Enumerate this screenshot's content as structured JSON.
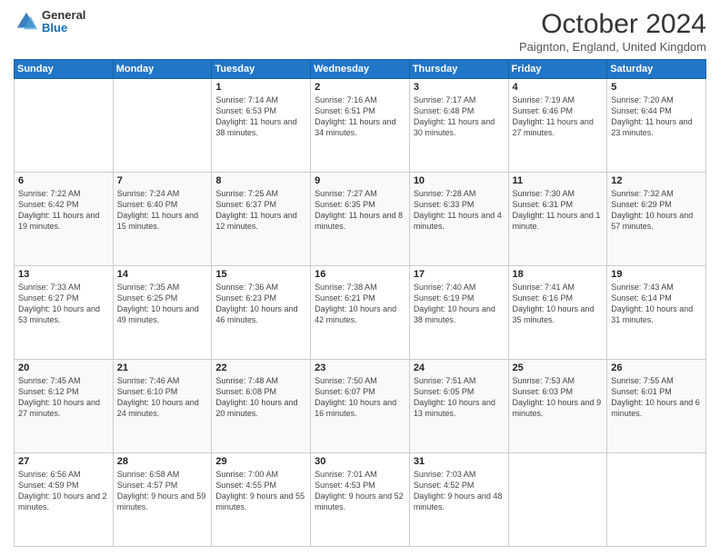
{
  "logo": {
    "general": "General",
    "blue": "Blue"
  },
  "header": {
    "title": "October 2024",
    "subtitle": "Paignton, England, United Kingdom"
  },
  "days_of_week": [
    "Sunday",
    "Monday",
    "Tuesday",
    "Wednesday",
    "Thursday",
    "Friday",
    "Saturday"
  ],
  "weeks": [
    [
      {
        "day": "",
        "info": ""
      },
      {
        "day": "",
        "info": ""
      },
      {
        "day": "1",
        "info": "Sunrise: 7:14 AM\nSunset: 6:53 PM\nDaylight: 11 hours and 38 minutes."
      },
      {
        "day": "2",
        "info": "Sunrise: 7:16 AM\nSunset: 6:51 PM\nDaylight: 11 hours and 34 minutes."
      },
      {
        "day": "3",
        "info": "Sunrise: 7:17 AM\nSunset: 6:48 PM\nDaylight: 11 hours and 30 minutes."
      },
      {
        "day": "4",
        "info": "Sunrise: 7:19 AM\nSunset: 6:46 PM\nDaylight: 11 hours and 27 minutes."
      },
      {
        "day": "5",
        "info": "Sunrise: 7:20 AM\nSunset: 6:44 PM\nDaylight: 11 hours and 23 minutes."
      }
    ],
    [
      {
        "day": "6",
        "info": "Sunrise: 7:22 AM\nSunset: 6:42 PM\nDaylight: 11 hours and 19 minutes."
      },
      {
        "day": "7",
        "info": "Sunrise: 7:24 AM\nSunset: 6:40 PM\nDaylight: 11 hours and 15 minutes."
      },
      {
        "day": "8",
        "info": "Sunrise: 7:25 AM\nSunset: 6:37 PM\nDaylight: 11 hours and 12 minutes."
      },
      {
        "day": "9",
        "info": "Sunrise: 7:27 AM\nSunset: 6:35 PM\nDaylight: 11 hours and 8 minutes."
      },
      {
        "day": "10",
        "info": "Sunrise: 7:28 AM\nSunset: 6:33 PM\nDaylight: 11 hours and 4 minutes."
      },
      {
        "day": "11",
        "info": "Sunrise: 7:30 AM\nSunset: 6:31 PM\nDaylight: 11 hours and 1 minute."
      },
      {
        "day": "12",
        "info": "Sunrise: 7:32 AM\nSunset: 6:29 PM\nDaylight: 10 hours and 57 minutes."
      }
    ],
    [
      {
        "day": "13",
        "info": "Sunrise: 7:33 AM\nSunset: 6:27 PM\nDaylight: 10 hours and 53 minutes."
      },
      {
        "day": "14",
        "info": "Sunrise: 7:35 AM\nSunset: 6:25 PM\nDaylight: 10 hours and 49 minutes."
      },
      {
        "day": "15",
        "info": "Sunrise: 7:36 AM\nSunset: 6:23 PM\nDaylight: 10 hours and 46 minutes."
      },
      {
        "day": "16",
        "info": "Sunrise: 7:38 AM\nSunset: 6:21 PM\nDaylight: 10 hours and 42 minutes."
      },
      {
        "day": "17",
        "info": "Sunrise: 7:40 AM\nSunset: 6:19 PM\nDaylight: 10 hours and 38 minutes."
      },
      {
        "day": "18",
        "info": "Sunrise: 7:41 AM\nSunset: 6:16 PM\nDaylight: 10 hours and 35 minutes."
      },
      {
        "day": "19",
        "info": "Sunrise: 7:43 AM\nSunset: 6:14 PM\nDaylight: 10 hours and 31 minutes."
      }
    ],
    [
      {
        "day": "20",
        "info": "Sunrise: 7:45 AM\nSunset: 6:12 PM\nDaylight: 10 hours and 27 minutes."
      },
      {
        "day": "21",
        "info": "Sunrise: 7:46 AM\nSunset: 6:10 PM\nDaylight: 10 hours and 24 minutes."
      },
      {
        "day": "22",
        "info": "Sunrise: 7:48 AM\nSunset: 6:08 PM\nDaylight: 10 hours and 20 minutes."
      },
      {
        "day": "23",
        "info": "Sunrise: 7:50 AM\nSunset: 6:07 PM\nDaylight: 10 hours and 16 minutes."
      },
      {
        "day": "24",
        "info": "Sunrise: 7:51 AM\nSunset: 6:05 PM\nDaylight: 10 hours and 13 minutes."
      },
      {
        "day": "25",
        "info": "Sunrise: 7:53 AM\nSunset: 6:03 PM\nDaylight: 10 hours and 9 minutes."
      },
      {
        "day": "26",
        "info": "Sunrise: 7:55 AM\nSunset: 6:01 PM\nDaylight: 10 hours and 6 minutes."
      }
    ],
    [
      {
        "day": "27",
        "info": "Sunrise: 6:56 AM\nSunset: 4:59 PM\nDaylight: 10 hours and 2 minutes."
      },
      {
        "day": "28",
        "info": "Sunrise: 6:58 AM\nSunset: 4:57 PM\nDaylight: 9 hours and 59 minutes."
      },
      {
        "day": "29",
        "info": "Sunrise: 7:00 AM\nSunset: 4:55 PM\nDaylight: 9 hours and 55 minutes."
      },
      {
        "day": "30",
        "info": "Sunrise: 7:01 AM\nSunset: 4:53 PM\nDaylight: 9 hours and 52 minutes."
      },
      {
        "day": "31",
        "info": "Sunrise: 7:03 AM\nSunset: 4:52 PM\nDaylight: 9 hours and 48 minutes."
      },
      {
        "day": "",
        "info": ""
      },
      {
        "day": "",
        "info": ""
      }
    ]
  ]
}
